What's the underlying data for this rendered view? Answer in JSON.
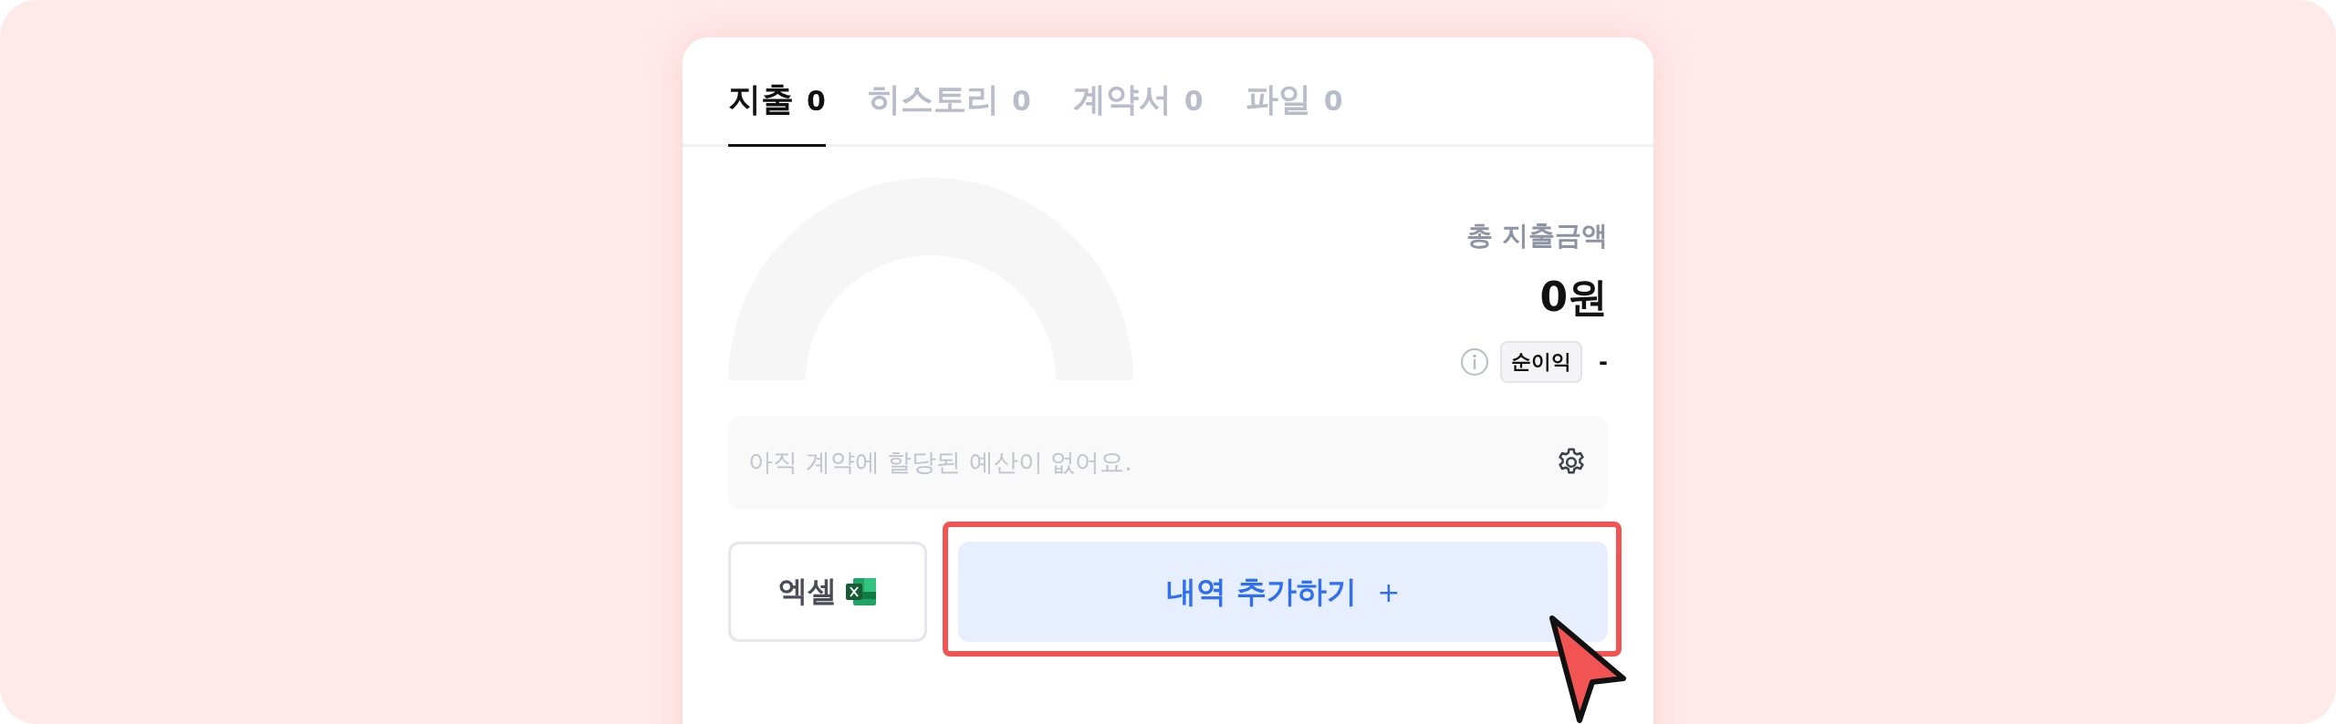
{
  "tabs": [
    {
      "label": "지출",
      "count": "0",
      "selected": true
    },
    {
      "label": "히스토리",
      "count": "0",
      "selected": false
    },
    {
      "label": "계약서",
      "count": "0",
      "selected": false
    },
    {
      "label": "파일",
      "count": "0",
      "selected": false
    }
  ],
  "summary": {
    "label": "총 지출금액",
    "amount": "0원",
    "profit_chip": "순이익",
    "profit_value": "-"
  },
  "budget": {
    "message": "아직 계약에 할당된 예산이 없어요."
  },
  "excel_button": {
    "label": "엑셀"
  },
  "add_button": {
    "label": "내역 추가하기",
    "icon": "+",
    "highlighted": true
  }
}
